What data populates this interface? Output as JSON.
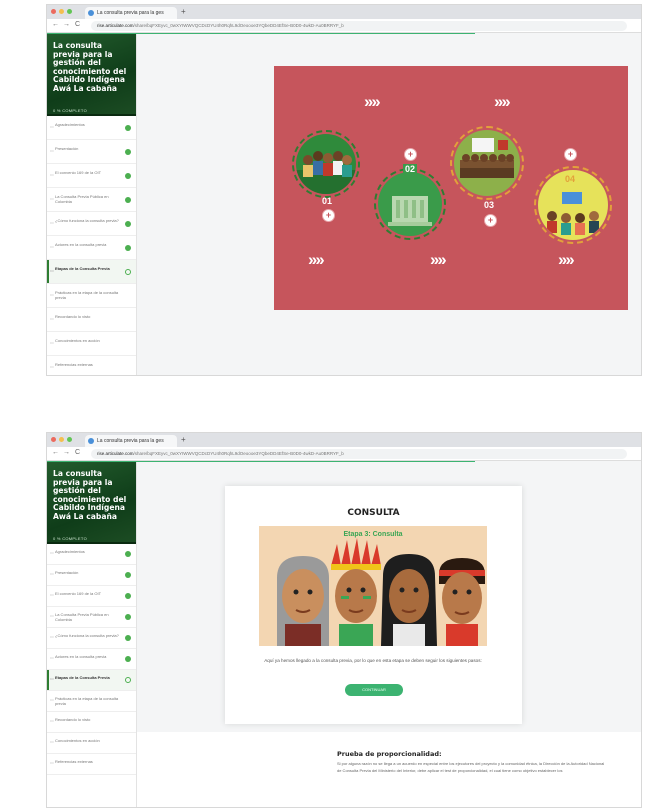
{
  "browser": {
    "tab_title": "La consulta previa para la ges",
    "url_host": "rise.articulate.com",
    "url_path": "/share/bqFXEyvc_0wXYIWWVQCDcDYU4h0RqhL9dOeoooe3YQbeDD4EfSe-B0D0-4wkD-Au0BRRYF_b",
    "new_tab": "+",
    "nav_back": "←",
    "nav_forward": "→",
    "nav_reload": "C"
  },
  "course": {
    "title": "La consulta previa para la gestión del conocimiento del Cabildo Indígena Awá La cabaña",
    "status": "0 % COMPLETO"
  },
  "menu": [
    {
      "label": "Agradecimientos",
      "state": "done"
    },
    {
      "label": "Presentación",
      "state": "done"
    },
    {
      "label": "El convenio 169 de la OIT",
      "state": "done"
    },
    {
      "label": "La Consulta Previa Pública en Colombia",
      "state": "done"
    },
    {
      "label": "¿Cómo funciona la consulta previa?",
      "state": "done"
    },
    {
      "label": "Actores en la consulta previa",
      "state": "done"
    },
    {
      "label": "Etapas de la Consulta Previa",
      "state": "progress",
      "active": true
    },
    {
      "label": "Prácticas en la etapa de la consulta previa",
      "state": "none"
    },
    {
      "label": "Recordando lo visto",
      "state": "none"
    },
    {
      "label": "Conocimientos en acción",
      "state": "none"
    },
    {
      "label": "Referencias externas",
      "state": "none"
    }
  ],
  "slide1": {
    "arrows": "››››",
    "stages": [
      "01",
      "02",
      "03",
      "04"
    ],
    "button_symbol": "+"
  },
  "slide2": {
    "card_title": "CONSULTA",
    "banner_title": "Etapa 3: Consulta",
    "text": "Aquí ya hemos llegado a la consulta previa, por lo que en esta etapa se deben seguir los siguientes pasos:",
    "button": "CONTINUAR",
    "next_symbol": "›",
    "section_title": "Prueba de proporcionalidad:",
    "section_text": "Si por alguna razón no se llega a un acuerdo en especial entre los ejecutores del proyecto y la comunidad étnica, la Dirección de la Autoridad Nacional de Consulta Previa del Ministerio del Interior, debe aplicar el test de proporcionalidad, el cual tiene como objetivo establecer los"
  },
  "colors": {
    "sidebar_header": "#1d4d24",
    "slide_background": "#c6555c",
    "accent_green": "#3cb371",
    "complete": "#4caf50"
  }
}
